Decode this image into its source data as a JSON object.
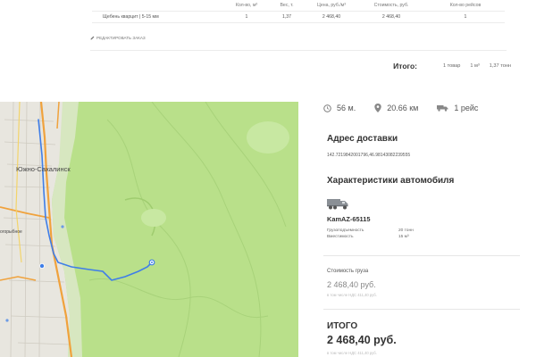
{
  "table": {
    "headers": [
      "",
      "Кол-во, м³",
      "Вес, т.",
      "Цена, руб./м³",
      "Стоимость, руб.",
      "Кол-во рейсов"
    ],
    "rows": [
      [
        "Щебень кварцит | 5-15 мм",
        "1",
        "1,37",
        "2 468,40",
        "2 468,40",
        "1"
      ]
    ]
  },
  "edit_order": "РЕДАКТИРОВАТЬ ЗАКАЗ",
  "totals": {
    "label": "Итого:",
    "items": "1 товар",
    "volume": "1 м³",
    "weight": "1,37 тонн"
  },
  "map": {
    "city_label": "Южно-Сахалинск",
    "small_label": "огорыбное"
  },
  "route": {
    "time": "56 м.",
    "distance": "20.66 км",
    "trips": "1 рейс"
  },
  "delivery": {
    "title": "Адрес доставки",
    "coords": "142.7219842001796,46.98143082239555"
  },
  "vehicle": {
    "title": "Характеристики автомобиля",
    "model": "KamAZ-65115",
    "specs": [
      {
        "key": "Грузоподъемность",
        "value": "20 тонн"
      },
      {
        "key": "Вместимость",
        "value": "15 м³"
      }
    ]
  },
  "cargo": {
    "title": "Стоимость груза",
    "price": "2 468,40 руб.",
    "note": "в том числе НДС 411,40 руб."
  },
  "total": {
    "title": "ИТОГО",
    "price": "2 468,40 руб.",
    "note": "в том числе НДС 411,40 руб."
  },
  "colors": {
    "map_green": "#b9e08a",
    "route_blue": "#3f7ee8",
    "road_orange": "#f0a23c"
  }
}
